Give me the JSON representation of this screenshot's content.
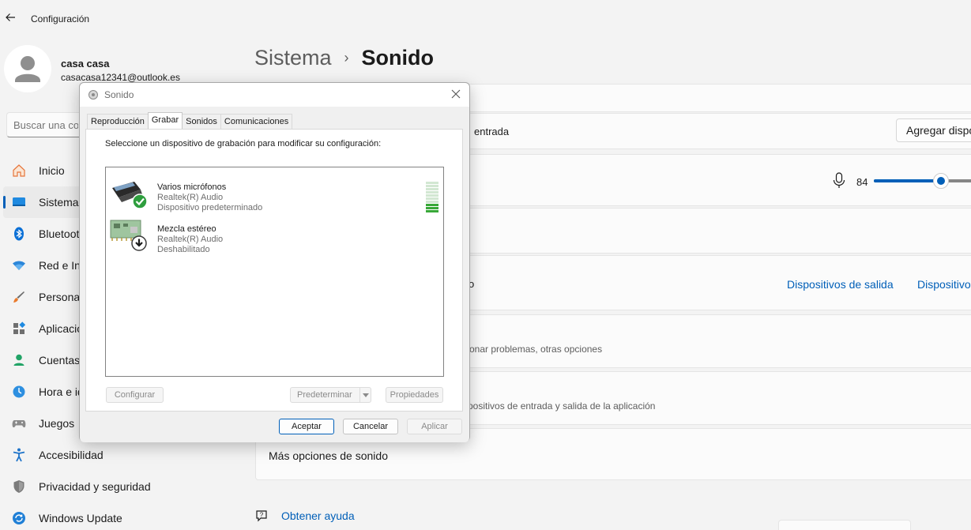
{
  "app": {
    "title": "Configuración"
  },
  "profile": {
    "name": "casa casa",
    "email": "casacasa12341@outlook.es"
  },
  "search": {
    "placeholder": "Buscar una co"
  },
  "nav": {
    "items": [
      {
        "label": "Inicio",
        "icon": "home-icon"
      },
      {
        "label": "Sistema",
        "icon": "system-icon",
        "active": true
      },
      {
        "label": "Bluetoot",
        "icon": "bluetooth-icon"
      },
      {
        "label": "Red e Int",
        "icon": "wifi-icon"
      },
      {
        "label": "Personal",
        "icon": "brush-icon"
      },
      {
        "label": "Aplicacio",
        "icon": "apps-icon"
      },
      {
        "label": "Cuentas",
        "icon": "accounts-icon"
      },
      {
        "label": "Hora e id",
        "icon": "time-language-icon"
      },
      {
        "label": "Juegos",
        "icon": "gamepad-icon"
      },
      {
        "label": "Accesibilidad",
        "icon": "accessibility-icon"
      },
      {
        "label": "Privacidad y seguridad",
        "icon": "shield-icon"
      },
      {
        "label": "Windows Update",
        "icon": "update-icon"
      }
    ]
  },
  "breadcrumb": {
    "parent": "Sistema",
    "separator": "›",
    "current": "Sonido"
  },
  "main": {
    "input_row_text": "entrada",
    "add_device_button": "Agregar dispo",
    "volume_value": "84",
    "volume_level": 0.65,
    "row_partial_o": "o",
    "output_devices_link": "Dispositivos de salida",
    "input_devices_link": "Dispositivo",
    "troubleshoot_sub": "onar problemas, otras opciones",
    "mixer_sub": "positivos de entrada y salida de la aplicación",
    "more_sound_options": "Más opciones de sonido",
    "get_help": "Obtener ayuda"
  },
  "dialog": {
    "title": "Sonido",
    "tabs": [
      "Reproducción",
      "Grabar",
      "Sonidos",
      "Comunicaciones"
    ],
    "active_tab": 1,
    "instruction": "Seleccione un dispositivo de grabación para modificar su configuración:",
    "devices": [
      {
        "name": "Varios micrófonos",
        "driver": "Realtek(R) Audio",
        "status": "Dispositivo predeterminado",
        "level": 0.3
      },
      {
        "name": "Mezcla estéreo",
        "driver": "Realtek(R) Audio",
        "status": "Deshabilitado"
      }
    ],
    "buttons": {
      "configure": "Configurar",
      "set_default": "Predeterminar",
      "properties": "Propiedades",
      "ok": "Aceptar",
      "cancel": "Cancelar",
      "apply": "Aplicar"
    }
  },
  "colors": {
    "accent": "#005fb8",
    "success": "#2e9e3e",
    "background": "#f3f3f3"
  }
}
